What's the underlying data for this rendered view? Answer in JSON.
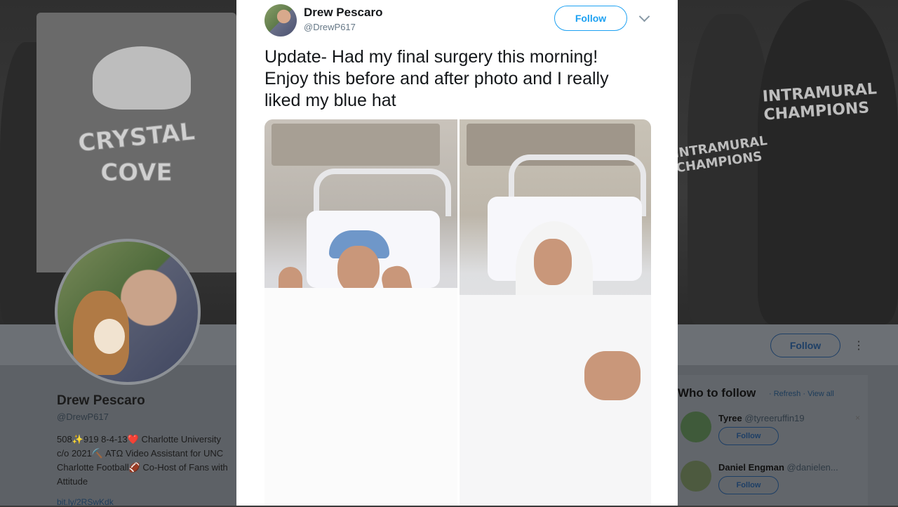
{
  "background_profile": {
    "shirt_text_line1": "CRYSTAL",
    "shirt_text_line2": "COVE",
    "tee_text": "INTRAMURAL CHAMPIONS",
    "tee_text_small": "INTRAMURAL CHAMPIONS",
    "name": "Drew Pescaro",
    "handle": "@DrewP617",
    "bio": "508✨919 8-4-13❤️ Charlotte University c/o 2021⛏️ ATΩ Video Assistant for UNC Charlotte Football🏈 Co-Host of Fans with Attitude",
    "link": "bit.ly/2RSwKdk",
    "follow_label": "Follow",
    "more_icon": "⋮"
  },
  "who_to_follow": {
    "title": "Who to follow",
    "refresh": "Refresh",
    "view_all": "View all",
    "separator": "·",
    "accounts": [
      {
        "name": "Tyree",
        "handle": "@tyreeruffin19",
        "follow_label": "Follow",
        "dismiss": "×"
      },
      {
        "name": "Daniel Engman",
        "handle": "@danielen...",
        "follow_label": "Follow",
        "dismiss": "×"
      }
    ]
  },
  "tweet": {
    "author_name": "Drew Pescaro",
    "author_handle": "@DrewP617",
    "follow_label": "Follow",
    "text": "Update- Had my final surgery this morning!\nEnjoy this before and after photo and I really\nliked my blue hat",
    "photo_description_icon": "photo-icon"
  },
  "colors": {
    "twitter_blue": "#1da1f2",
    "dim_blue": "#1e3f66",
    "text_primary": "#14171a",
    "text_secondary": "#657786"
  }
}
